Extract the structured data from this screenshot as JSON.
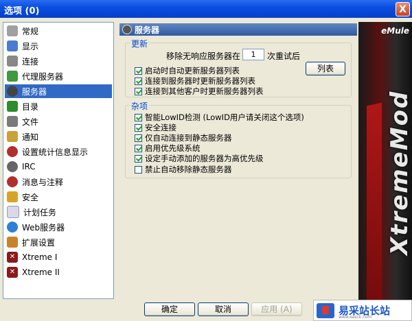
{
  "window": {
    "title": "选项 (0)",
    "close": "X"
  },
  "sidebar": {
    "items": [
      {
        "label": "常规",
        "icon": "general-icon"
      },
      {
        "label": "显示",
        "icon": "display-icon"
      },
      {
        "label": "连接",
        "icon": "connection-icon"
      },
      {
        "label": "代理服务器",
        "icon": "proxy-icon"
      },
      {
        "label": "服务器",
        "icon": "server-icon"
      },
      {
        "label": "目录",
        "icon": "directory-icon"
      },
      {
        "label": "文件",
        "icon": "files-icon"
      },
      {
        "label": "通知",
        "icon": "notification-icon"
      },
      {
        "label": "设置统计信息显示",
        "icon": "statistics-icon"
      },
      {
        "label": "IRC",
        "icon": "irc-icon"
      },
      {
        "label": "消息与注释",
        "icon": "messages-icon"
      },
      {
        "label": "安全",
        "icon": "security-icon"
      },
      {
        "label": "计划任务",
        "icon": "scheduler-icon"
      },
      {
        "label": "Web服务器",
        "icon": "web-server-icon"
      },
      {
        "label": "扩展设置",
        "icon": "extended-icon"
      },
      {
        "label": "Xtreme I",
        "icon": "xtreme-icon"
      },
      {
        "label": "Xtreme II",
        "icon": "xtreme-icon"
      }
    ],
    "selected": "服务器"
  },
  "panel": {
    "title": "服务器"
  },
  "update": {
    "title": "更新",
    "remove_prefix": "移除无响应服务器在",
    "retry_value": "1",
    "remove_suffix": "次重试后",
    "list_button": "列表",
    "checks": [
      {
        "label": "启动时自动更新服务器列表",
        "checked": true
      },
      {
        "label": "连接到服务器时更新服务器列表",
        "checked": true
      },
      {
        "label": "连接到其他客户时更新服务器列表",
        "checked": true
      }
    ]
  },
  "misc": {
    "title": "杂项",
    "checks": [
      {
        "label": "智能LowID检测 (LowID用户请关闭这个选项)",
        "checked": true
      },
      {
        "label": "安全连接",
        "checked": true
      },
      {
        "label": "仅自动连接到静态服务器",
        "checked": true
      },
      {
        "label": "启用优先级系统",
        "checked": true
      },
      {
        "label": "设定手动添加的服务器为高优先级",
        "checked": true
      },
      {
        "label": "禁止自动移除静态服务器",
        "checked": false
      }
    ]
  },
  "buttons": {
    "ok": "确定",
    "cancel": "取消",
    "apply": "应用 (A)"
  },
  "banner": {
    "brand": "eMule",
    "mod_text": "XtremeMod"
  },
  "watermark": {
    "name": "易采站长站",
    "url": "www.easck.com"
  },
  "colors": {
    "accent": "#316ac5",
    "titlebar": "#0a4ee0"
  }
}
